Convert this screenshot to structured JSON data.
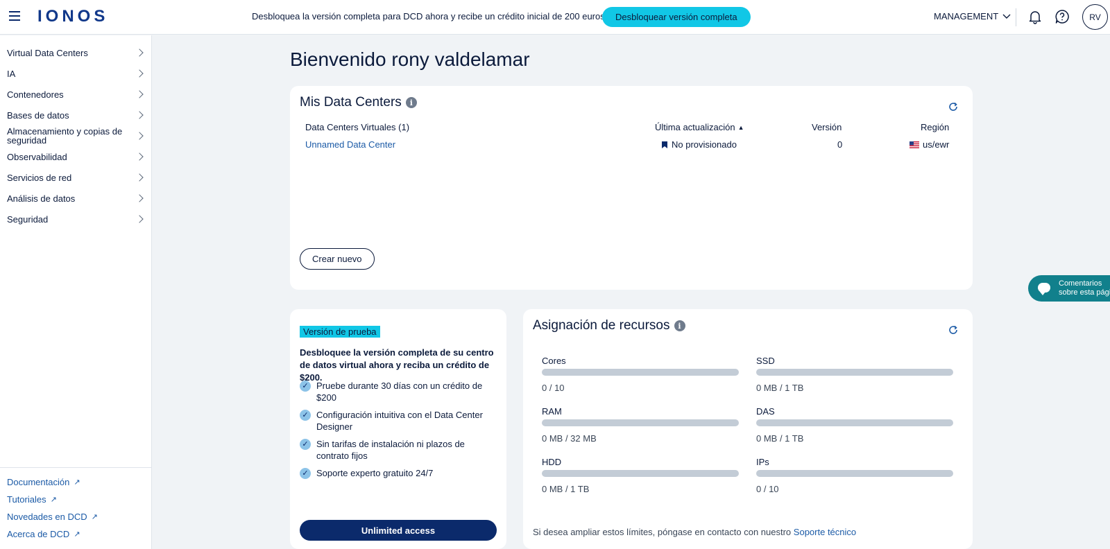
{
  "header": {
    "logo": "IONOS",
    "promo_text": "Desbloquea la versión completa para DCD ahora y recibe un crédito inicial de 200 euros.",
    "promo_button": "Desbloquear versión completa",
    "management_label": "MANAGEMENT",
    "avatar_initials": "RV"
  },
  "sidebar": {
    "items": [
      {
        "label": "Virtual Data Centers"
      },
      {
        "label": "IA"
      },
      {
        "label": "Contenedores"
      },
      {
        "label": "Bases de datos"
      },
      {
        "label": "Almacenamiento y copias de seguridad"
      },
      {
        "label": "Observabilidad"
      },
      {
        "label": "Servicios de red"
      },
      {
        "label": "Análisis de datos"
      },
      {
        "label": "Seguridad"
      }
    ],
    "footer_links": [
      {
        "label": "Documentación"
      },
      {
        "label": "Tutoriales"
      },
      {
        "label": "Novedades en DCD"
      },
      {
        "label": "Acerca de DCD"
      }
    ]
  },
  "main": {
    "welcome": "Bienvenido rony valdelamar",
    "data_centers": {
      "title": "Mis Data Centers",
      "columns": {
        "name": "Data Centers Virtuales (1)",
        "updated": "Última actualización",
        "version": "Versión",
        "region": "Región"
      },
      "rows": [
        {
          "name": "Unnamed Data Center",
          "status": "No provisionado",
          "version": "0",
          "region": "us/ewr"
        }
      ],
      "create_button": "Crear nuevo"
    },
    "trial": {
      "badge": "Versión de prueba",
      "headline": "Desbloquee la versión completa de su centro de datos virtual ahora y reciba un crédito de $200.",
      "benefits": [
        "Pruebe durante 30 días con un crédito de $200",
        "Configuración intuitiva con el Data Center Designer",
        "Sin tarifas de instalación ni plazos de contrato fijos",
        "Soporte experto gratuito 24/7"
      ],
      "button": "Unlimited access"
    },
    "resources": {
      "title": "Asignación de recursos",
      "items": [
        {
          "label": "Cores",
          "value": "0 / 10",
          "usage": 0
        },
        {
          "label": "SSD",
          "value": "0 MB / 1 TB",
          "usage": 0
        },
        {
          "label": "RAM",
          "value": "0 MB / 32 MB",
          "usage": 0
        },
        {
          "label": "DAS",
          "value": "0 MB / 1 TB",
          "usage": 0
        },
        {
          "label": "HDD",
          "value": "0 MB / 1 TB",
          "usage": 0
        },
        {
          "label": "IPs",
          "value": "0 / 10",
          "usage": 0
        }
      ],
      "footer_text": "Si desea ampliar estos límites, póngase en contacto con nuestro",
      "footer_link": "Soporte técnico"
    }
  },
  "feedback": {
    "line1": "Comentarios",
    "line2": "sobre esta págin"
  },
  "colors": {
    "brand": "#11388a",
    "accent": "#11c7e6",
    "navy": "#0b2a6b",
    "link": "#1b5aa6",
    "feedback": "#11808c"
  }
}
